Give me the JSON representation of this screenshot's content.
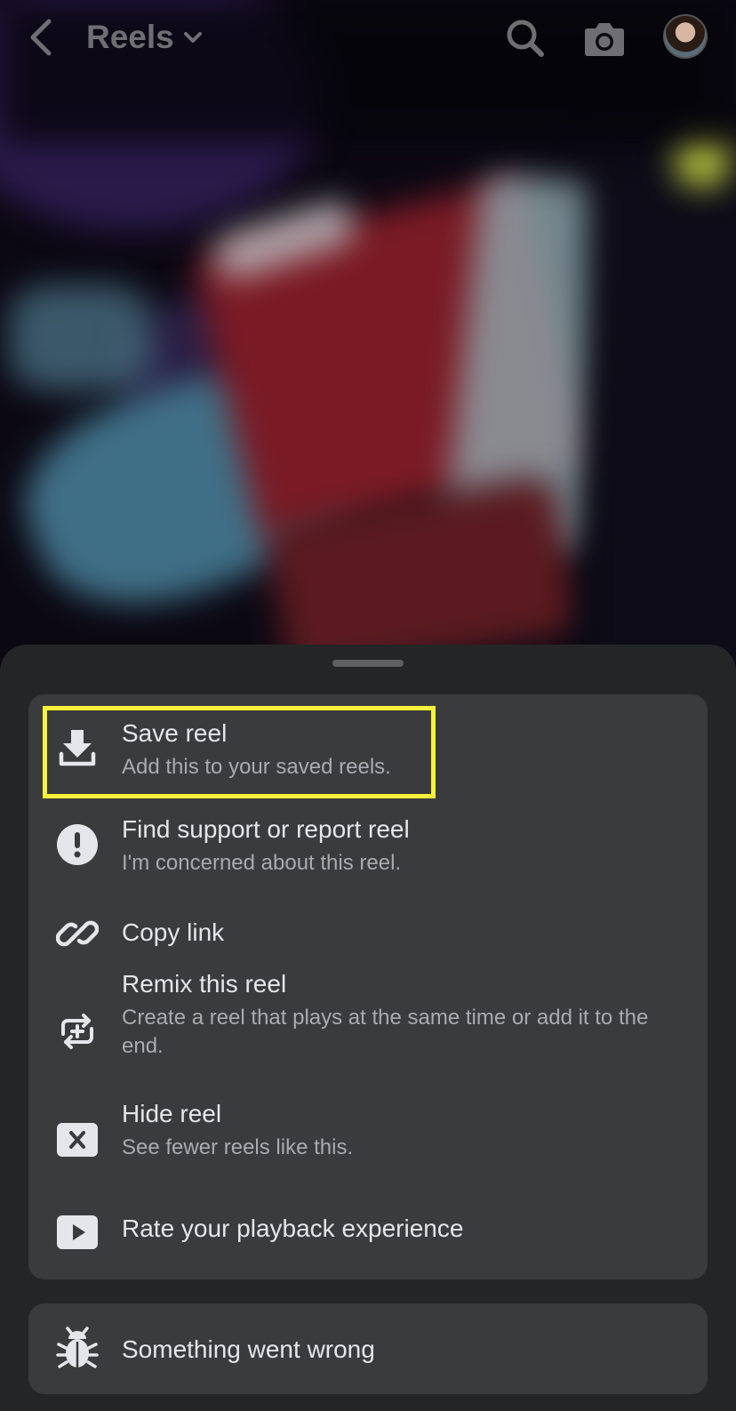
{
  "header": {
    "title": "Reels"
  },
  "menu": {
    "items": [
      {
        "label": "Save reel",
        "sub": "Add this to your saved reels."
      },
      {
        "label": "Find support or report reel",
        "sub": "I'm concerned about this reel."
      },
      {
        "label": "Copy link"
      },
      {
        "label": "Remix this reel",
        "sub": "Create a reel that plays at the same time or add it to the end."
      },
      {
        "label": "Hide reel",
        "sub": "See fewer reels like this."
      },
      {
        "label": "Rate your playback experience"
      }
    ],
    "secondary": {
      "label": "Something went wrong"
    }
  },
  "colors": {
    "sheet_bg": "#242526",
    "card_bg": "#3a3b3c",
    "highlight": "#f6f33a"
  }
}
